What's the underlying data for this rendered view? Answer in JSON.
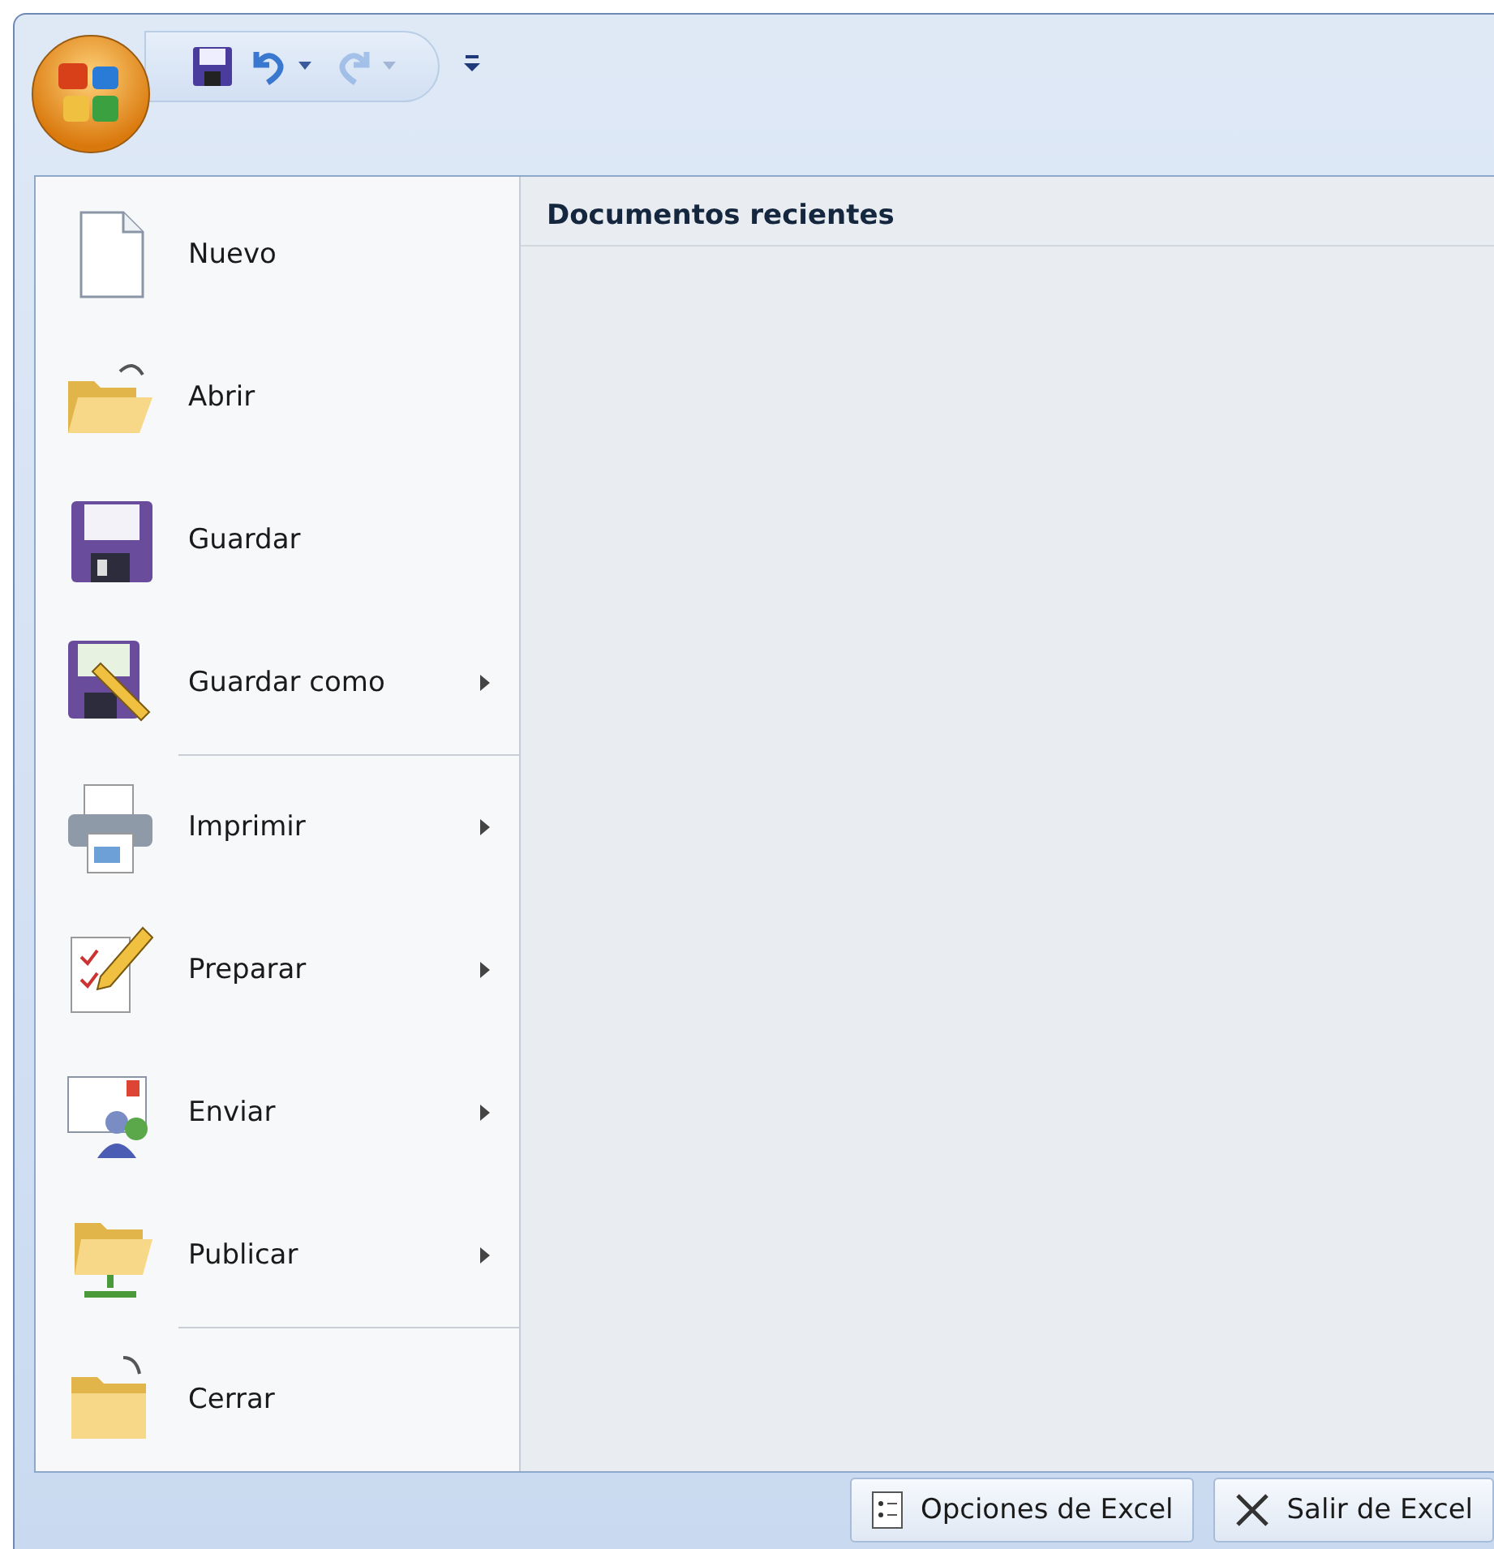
{
  "quick_access": {
    "undo_enabled": true,
    "redo_enabled": false
  },
  "menu": {
    "items": [
      {
        "kind": "new",
        "label": "Nuevo",
        "submenu": false,
        "separator_after": false
      },
      {
        "kind": "open",
        "label": "Abrir",
        "submenu": false,
        "separator_after": false
      },
      {
        "kind": "save",
        "label": "Guardar",
        "submenu": false,
        "separator_after": false
      },
      {
        "kind": "saveas",
        "label": "Guardar como",
        "submenu": true,
        "separator_after": true
      },
      {
        "kind": "print",
        "label": "Imprimir",
        "submenu": true,
        "separator_after": false
      },
      {
        "kind": "prepare",
        "label": "Preparar",
        "submenu": true,
        "separator_after": false
      },
      {
        "kind": "send",
        "label": "Enviar",
        "submenu": true,
        "separator_after": false
      },
      {
        "kind": "publish",
        "label": "Publicar",
        "submenu": true,
        "separator_after": true
      },
      {
        "kind": "close",
        "label": "Cerrar",
        "submenu": false,
        "separator_after": false
      }
    ]
  },
  "recent": {
    "title": "Documentos recientes"
  },
  "footer_buttons": [
    {
      "kind": "options",
      "label": "Opciones de Excel"
    },
    {
      "kind": "exit",
      "label": "Salir de Excel"
    }
  ]
}
